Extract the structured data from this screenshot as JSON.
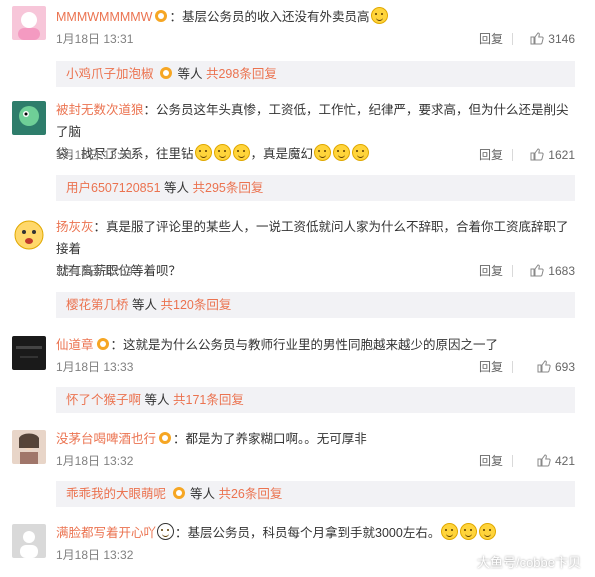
{
  "comments": [
    {
      "username": "MMMWMMMMW",
      "separator": "：",
      "content": "基层公务员的收入还没有外卖员高",
      "emojis": [
        "smile-emoji"
      ],
      "time": "1月18日 13:31",
      "reply_label": "回复",
      "likes": "3146",
      "replies": {
        "name": "小鸡爪子加泡椒",
        "middle": "等人",
        "total": "共298条回复"
      }
    },
    {
      "username": "被封无数次道狼",
      "separator": "：",
      "content_line1": "公务员这年头真惨，工资低，工作忙，纪律严，要求高，但为什么还是削尖了脑",
      "content_line2": "袋，找尽了关系，往里钻",
      "content_line2_suffix": "，真是魔幻",
      "time": "1月18日 13:31",
      "reply_label": "回复",
      "likes": "1621",
      "replies": {
        "name": "用户6507120851",
        "middle": "等人",
        "total": "共295条回复"
      }
    },
    {
      "username": "扬灰灰",
      "separator": "：",
      "content_line1": "真是服了评论里的某些人，一说工资低就问人家为什么不辞职，合着你工资底辞职了接着",
      "content_line2": "就有高薪职位等着呗？",
      "time": "1月18日 13:54",
      "reply_label": "回复",
      "likes": "1683",
      "replies": {
        "name": "樱花第几桥",
        "middle": "等人",
        "total": "共120条回复"
      }
    },
    {
      "username": "仙道章",
      "separator": "：",
      "content": "这就是为什么公务员与教师行业里的男性同胞越来越少的原因之一了",
      "time": "1月18日 13:33",
      "reply_label": "回复",
      "likes": "693",
      "replies": {
        "name": "怀了个猴子啊",
        "middle": "等人",
        "total": "共171条回复"
      }
    },
    {
      "username": "没茅台喝啤酒也行",
      "separator": "：",
      "content": "都是为了养家糊口啊。。无可厚非",
      "time": "1月18日 13:32",
      "reply_label": "回复",
      "likes": "421",
      "replies": {
        "name": "乖乖我的大眼萌呢",
        "middle": "等人",
        "total": "共26条回复"
      }
    },
    {
      "username": "满脸都写着开心吖",
      "separator": "：",
      "content": "基层公务员，科员每个月拿到手就3000左右。",
      "time": "1月18日 13:32",
      "reply_label": "回复",
      "likes": "",
      "replies": null
    }
  ],
  "watermark": "大鱼号/cobbe卞贝",
  "colors": {
    "username": "#eb7350",
    "meta": "#808080",
    "sub_bg": "#f2f2f5"
  }
}
